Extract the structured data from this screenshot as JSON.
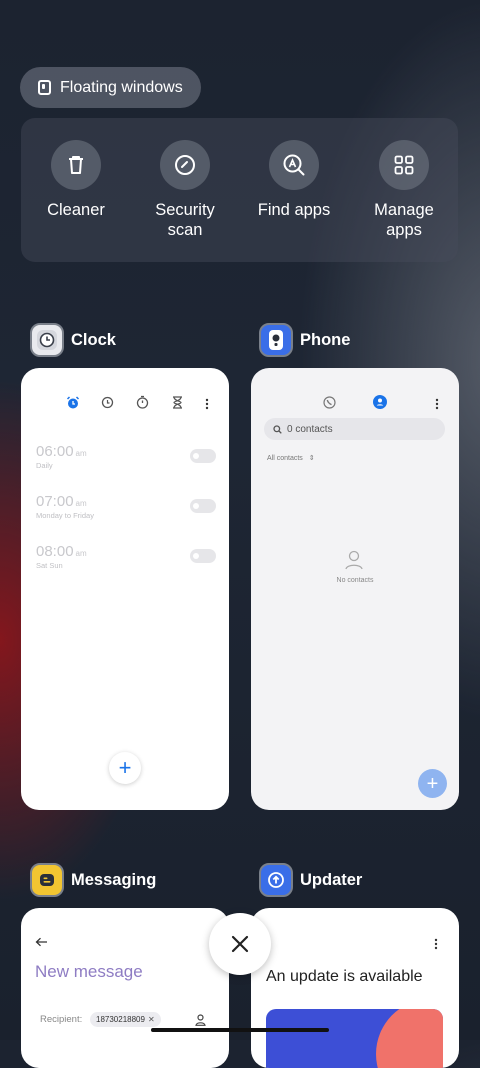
{
  "floating_windows": {
    "label": "Floating windows",
    "icon": "floating-window-icon"
  },
  "tools": [
    {
      "label": "Cleaner",
      "icon": "trash-icon"
    },
    {
      "label": "Security scan",
      "icon": "shield-scan-icon"
    },
    {
      "label": "Find apps",
      "icon": "search-apps-icon"
    },
    {
      "label": "Manage apps",
      "icon": "grid-icon"
    }
  ],
  "apps": {
    "clock": {
      "title": "Clock",
      "alarms": [
        {
          "time": "06:00",
          "ampm": "am",
          "repeat": "Daily"
        },
        {
          "time": "07:00",
          "ampm": "am",
          "repeat": "Monday to Friday"
        },
        {
          "time": "08:00",
          "ampm": "am",
          "repeat": "Sat Sun"
        }
      ],
      "fab": "+"
    },
    "phone": {
      "title": "Phone",
      "search_placeholder": "0 contacts",
      "filter": "All contacts",
      "empty_text": "No contacts",
      "fab": "+"
    },
    "messaging": {
      "title": "Messaging",
      "heading": "New message",
      "recipient_label": "Recipient:",
      "recipient_chip": "18730218809"
    },
    "updater": {
      "title": "Updater",
      "heading": "An update is available"
    }
  },
  "close_button": "×",
  "colors": {
    "accent": "#1a73e8",
    "message_purple": "#8e7cc3",
    "phone_fab": "#8fb4f0"
  }
}
